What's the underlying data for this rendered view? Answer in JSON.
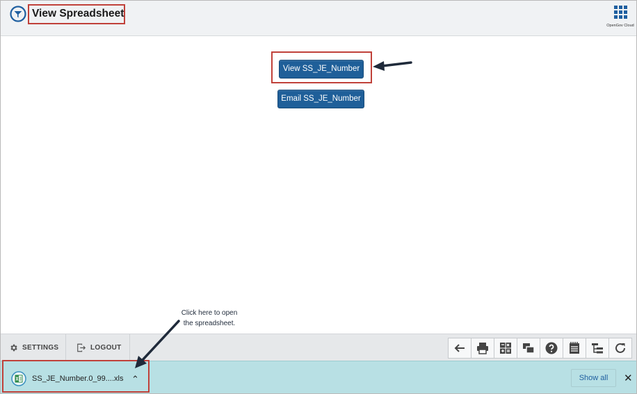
{
  "header": {
    "title": "View Spreadsheet",
    "apps_label": "OpenGov Cloud",
    "logo_icon": "opengov-logo-icon",
    "apps_icon": "app-grid-icon"
  },
  "main": {
    "view_button": "View SS_JE_Number",
    "email_button": "Email SS_JE_Number"
  },
  "annotation": {
    "line1": "Click here to open",
    "line2": "the spreadsheet."
  },
  "footer": {
    "settings": "SETTINGS",
    "logout": "LOGOUT",
    "tools": [
      "back-arrow-icon",
      "print-icon",
      "calculator-icon",
      "windows-icon",
      "help-icon",
      "notepad-icon",
      "hierarchy-icon",
      "refresh-icon"
    ]
  },
  "download_bar": {
    "file_name": "SS_JE_Number.0_99....xls",
    "file_icon": "spreadsheet-file-icon",
    "show_all": "Show all",
    "close": "✕",
    "chevron": "⌃"
  },
  "colors": {
    "button_blue": "#1f5f99",
    "highlight_red": "#c0413a",
    "download_bar": "#b8e0e4",
    "arrow": "#1f2a3a"
  }
}
